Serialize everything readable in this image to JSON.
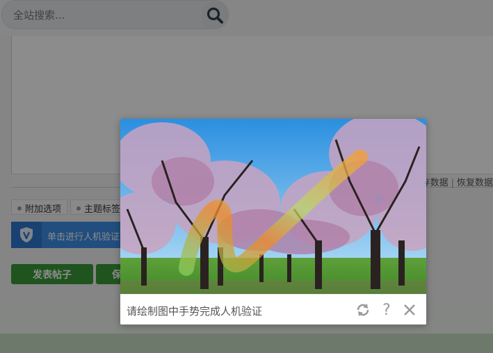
{
  "search": {
    "placeholder": "全站搜索...",
    "icon": "search-icon"
  },
  "editor": {
    "save_data": "保存数据",
    "separator": "|",
    "restore_data": "恢复数据"
  },
  "options": {
    "tabs": [
      {
        "label": "附加选项"
      },
      {
        "label": "主题标签"
      }
    ]
  },
  "verify": {
    "label": "单击进行人机验证",
    "icon": "shield-v-icon"
  },
  "actions": {
    "post_label": "发表帖子",
    "second_label": "保"
  },
  "captcha": {
    "prompt": "请绘制图中手势完成人机验证",
    "icons": [
      "refresh-icon",
      "help-icon",
      "close-icon"
    ],
    "help_glyph": "?",
    "image_subject": "blossoming almond trees with a gesture stroke"
  },
  "colors": {
    "accent_blue": "#3d8ee6",
    "button_green": "#3a9a3a",
    "overlay": "rgba(0,0,0,0.45)"
  }
}
